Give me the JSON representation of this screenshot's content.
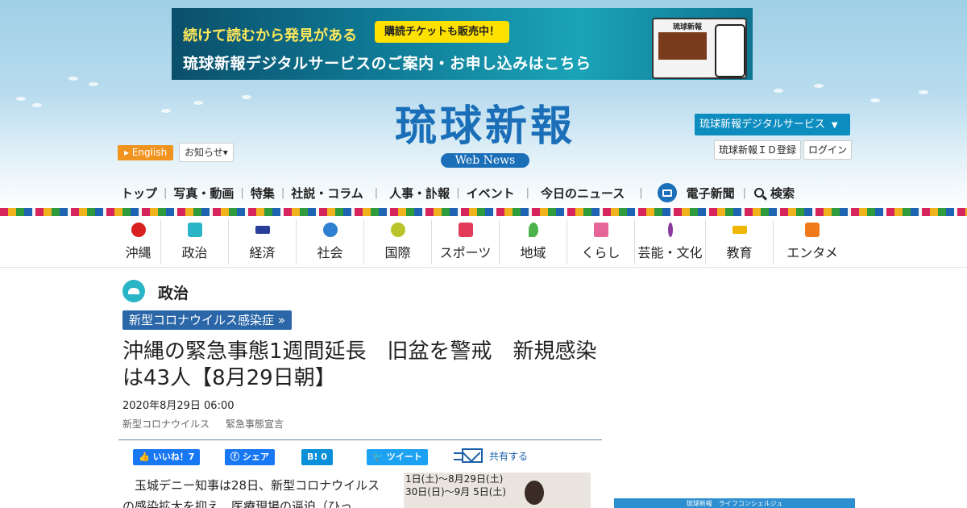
{
  "banner": {
    "tagline": "続けて読むから発見がある",
    "badge": "購読チケットも販売中！",
    "main": "琉球新報デジタルサービスのご案内・お申し込みはこちら",
    "device_label": "琉球新報"
  },
  "logo": {
    "title": "琉球新報",
    "subtitle": "Web News"
  },
  "header": {
    "english": "English",
    "oshirase": "お知らせ",
    "digital_service": "琉球新報デジタルサービス",
    "id_register": "琉球新報ＩＤ登録",
    "login": "ログイン"
  },
  "mainnav": [
    {
      "label": "トップ"
    },
    {
      "label": "写真・動画"
    },
    {
      "label": "特集"
    },
    {
      "label": "社説・コラム"
    },
    {
      "label": "人事・訃報"
    },
    {
      "label": "イベント"
    },
    {
      "label": "今日のニュース"
    },
    {
      "label": "電子新聞"
    },
    {
      "label": "検索"
    }
  ],
  "categories": [
    {
      "label": "沖縄",
      "icon": "hibiscus-icon",
      "color": "#d8201f"
    },
    {
      "label": "政治",
      "icon": "capitol-icon",
      "color": "#2ab5c6"
    },
    {
      "label": "経済",
      "icon": "chart-icon",
      "color": "#2a3f9a"
    },
    {
      "label": "社会",
      "icon": "people-icon",
      "color": "#2f80d0"
    },
    {
      "label": "国際",
      "icon": "globe-icon",
      "color": "#b8c42a"
    },
    {
      "label": "スポーツ",
      "icon": "runner-icon",
      "color": "#e33a5a"
    },
    {
      "label": "地域",
      "icon": "pin-icon",
      "color": "#4cb34a"
    },
    {
      "label": "くらし",
      "icon": "house-icon",
      "color": "#e7669a"
    },
    {
      "label": "芸能・文化",
      "icon": "sanshin-icon",
      "color": "#8a3a9c"
    },
    {
      "label": "教育",
      "icon": "mortarboard-icon",
      "color": "#f0b500"
    },
    {
      "label": "エンタメ",
      "icon": "tv-icon",
      "color": "#f07a1a"
    }
  ],
  "article": {
    "section": "政治",
    "tag": "新型コロナウイルス感染症 »",
    "headline": "沖縄の緊急事態1週間延長　旧盆を警戒　新規感染は43人【8月29日朝】",
    "date": "2020年8月29日 06:00",
    "keywords": [
      "新型コロナウイルス",
      "緊急事態宣言"
    ],
    "body": "玉城デニー知事は28日、新型コロナウイルスの感染拡大を抑え、医療現場の逼迫（ひっ",
    "photo_caption": [
      "1日(土)～8月29日(土)",
      "30日(日)～9月 5日(土)"
    ]
  },
  "share": {
    "fb_like": "いいね！7",
    "fb_share": "シェア",
    "hatena": "B!  0",
    "tweet": "ツイート",
    "mail": "共有する"
  },
  "side": {
    "banner_text": "琉球新報　ライフコンシェルジュ"
  }
}
